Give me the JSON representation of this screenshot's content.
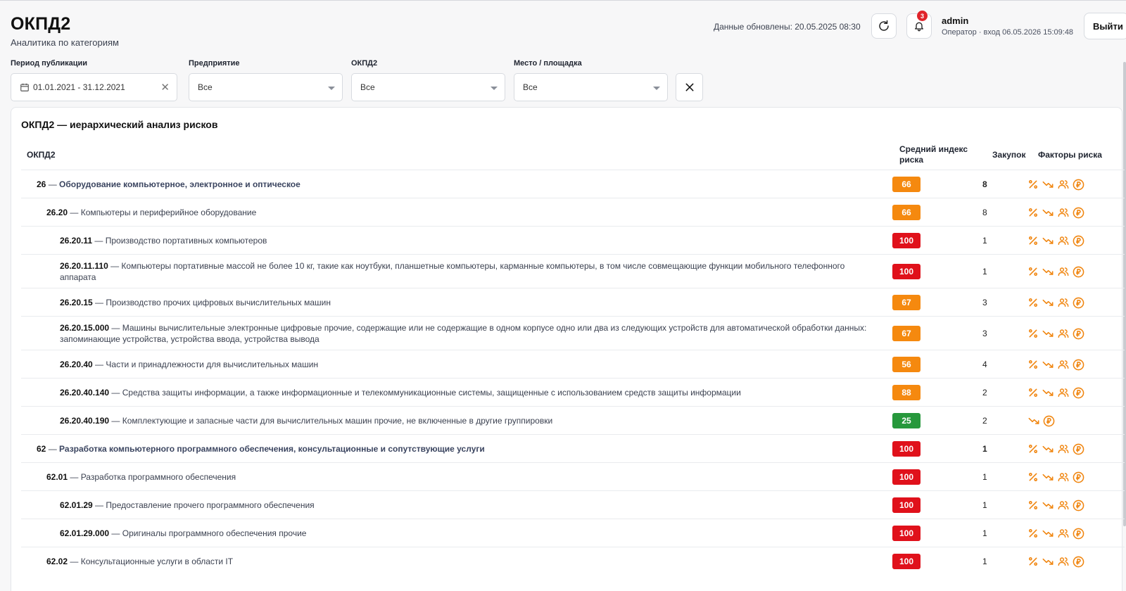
{
  "header": {
    "title": "ОКПД2",
    "subtitle": "Аналитика по категориям",
    "updated": "Данные обновлены: 20.05.2025 08:30",
    "notifications": "3",
    "user_name": "admin",
    "user_role": "Оператор · вход 06.05.2026 15:09:48",
    "logout_label": "Выйти"
  },
  "filters": {
    "period_label": "Период публикации",
    "period_value": "01.01.2021 - 31.12.2021",
    "company_label": "Предприятие",
    "company_value": "Все",
    "okpd_label": "ОКПД2",
    "okpd_value": "Все",
    "place_label": "Место / площадка",
    "place_value": "Все"
  },
  "table": {
    "title": "ОКПД2 — иерархический анализ рисков",
    "col_okpd": "ОКПД2",
    "col_risk": "Средний индекс риска",
    "col_count": "Закупок",
    "col_factors": "Факторы риска",
    "rows": [
      {
        "code": "26",
        "desc": "Оборудование компьютерное, электронное и оптическое",
        "risk": "66",
        "risk_color": "#f5890f",
        "count": "8",
        "level": 0,
        "factors": [
          "percent-icon",
          "trend-down-icon",
          "users-icon",
          "ruble-coin-icon"
        ]
      },
      {
        "code": "26.20",
        "desc": "Компьютеры и периферийное оборудование",
        "risk": "66",
        "risk_color": "#f5890f",
        "count": "8",
        "level": 1,
        "factors": [
          "percent-icon",
          "trend-down-icon",
          "users-icon",
          "ruble-coin-icon"
        ]
      },
      {
        "code": "26.20.11",
        "desc": "Производство портативных компьютеров",
        "risk": "100",
        "risk_color": "#e0111b",
        "count": "1",
        "level": 2,
        "factors": [
          "percent-icon",
          "trend-down-icon",
          "users-icon",
          "ruble-coin-icon"
        ]
      },
      {
        "code": "26.20.11.110",
        "desc": "Компьютеры портативные массой не более 10 кг, такие как ноутбуки, планшетные компьютеры, карманные компьютеры, в том числе совмещающие функции мобильного телефонного аппарата",
        "risk": "100",
        "risk_color": "#e0111b",
        "count": "1",
        "level": 2,
        "factors": [
          "percent-icon",
          "trend-down-icon",
          "users-icon",
          "ruble-coin-icon"
        ]
      },
      {
        "code": "26.20.15",
        "desc": "Производство прочих цифровых вычислительных машин",
        "risk": "67",
        "risk_color": "#f5890f",
        "count": "3",
        "level": 2,
        "factors": [
          "percent-icon",
          "trend-down-icon",
          "users-icon",
          "ruble-coin-icon"
        ]
      },
      {
        "code": "26.20.15.000",
        "desc": "Машины вычислительные электронные цифровые прочие, содержащие или не содержащие в одном корпусе одно или два из следующих устройств для автоматической обработки данных: запоминающие устройства, устройства ввода, устройства вывода",
        "risk": "67",
        "risk_color": "#f5890f",
        "count": "3",
        "level": 2,
        "factors": [
          "percent-icon",
          "trend-down-icon",
          "users-icon",
          "ruble-coin-icon"
        ]
      },
      {
        "code": "26.20.40",
        "desc": "Части и принадлежности для вычислительных машин",
        "risk": "56",
        "risk_color": "#f5890f",
        "count": "4",
        "level": 2,
        "factors": [
          "percent-icon",
          "trend-down-icon",
          "users-icon",
          "ruble-coin-icon"
        ]
      },
      {
        "code": "26.20.40.140",
        "desc": "Средства защиты информации, а также информационные и телекоммуникационные системы, защищенные с использованием средств защиты информации",
        "risk": "88",
        "risk_color": "#f5890f",
        "count": "2",
        "level": 2,
        "factors": [
          "percent-icon",
          "trend-down-icon",
          "users-icon",
          "ruble-coin-icon"
        ]
      },
      {
        "code": "26.20.40.190",
        "desc": "Комплектующие и запасные части для вычислительных машин прочие, не включенные в другие группировки",
        "risk": "25",
        "risk_color": "#27983c",
        "count": "2",
        "level": 2,
        "factors": [
          "trend-down-icon",
          "ruble-coin-icon"
        ]
      },
      {
        "code": "62",
        "desc": "Разработка компьютерного программного обеспечения, консультационные и сопутствующие услуги",
        "risk": "100",
        "risk_color": "#e0111b",
        "count": "1",
        "level": 0,
        "factors": [
          "percent-icon",
          "trend-down-icon",
          "users-icon",
          "ruble-coin-icon"
        ]
      },
      {
        "code": "62.01",
        "desc": "Разработка программного обеспечения",
        "risk": "100",
        "risk_color": "#e0111b",
        "count": "1",
        "level": 1,
        "factors": [
          "percent-icon",
          "trend-down-icon",
          "users-icon",
          "ruble-coin-icon"
        ]
      },
      {
        "code": "62.01.29",
        "desc": "Предоставление прочего программного обеспечения",
        "risk": "100",
        "risk_color": "#e0111b",
        "count": "1",
        "level": 2,
        "factors": [
          "percent-icon",
          "trend-down-icon",
          "users-icon",
          "ruble-coin-icon"
        ]
      },
      {
        "code": "62.01.29.000",
        "desc": "Оригиналы программного обеспечения прочие",
        "risk": "100",
        "risk_color": "#e0111b",
        "count": "1",
        "level": 2,
        "factors": [
          "percent-icon",
          "trend-down-icon",
          "users-icon",
          "ruble-coin-icon"
        ]
      },
      {
        "code": "62.02",
        "desc": "Консультационные услуги в области IT",
        "risk": "100",
        "risk_color": "#e0111b",
        "count": "1",
        "level": 1,
        "factors": [
          "percent-icon",
          "trend-down-icon",
          "users-icon",
          "ruble-coin-icon"
        ]
      }
    ]
  }
}
